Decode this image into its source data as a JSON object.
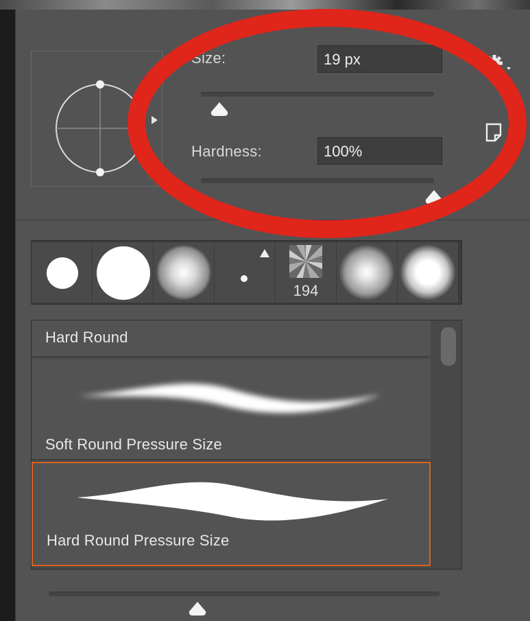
{
  "size": {
    "label": "Size:",
    "value": "19 px",
    "slider_fraction": 0.08
  },
  "hardness": {
    "label": "Hardness:",
    "value": "100%",
    "slider_fraction": 1.0
  },
  "icons": {
    "settings": "gear-icon",
    "new_preset": "new-preset-icon",
    "preview_arrow": "triangle-right-icon"
  },
  "brush_tips": [
    {
      "kind": "hard-small"
    },
    {
      "kind": "hard-large"
    },
    {
      "kind": "soft-large"
    },
    {
      "kind": "tiny-dot"
    },
    {
      "kind": "texture",
      "count": "194"
    },
    {
      "kind": "soft-medium"
    },
    {
      "kind": "soft-glow"
    }
  ],
  "presets": [
    {
      "name": "Hard Round",
      "selected": false
    },
    {
      "name": "Soft Round Pressure Size",
      "selected": false
    },
    {
      "name": "Hard Round Pressure Size",
      "selected": true
    }
  ],
  "bottom_slider_fraction": 0.38,
  "colors": {
    "panel": "#535353",
    "annotation": "#e0251b",
    "selection": "#d8631f"
  }
}
